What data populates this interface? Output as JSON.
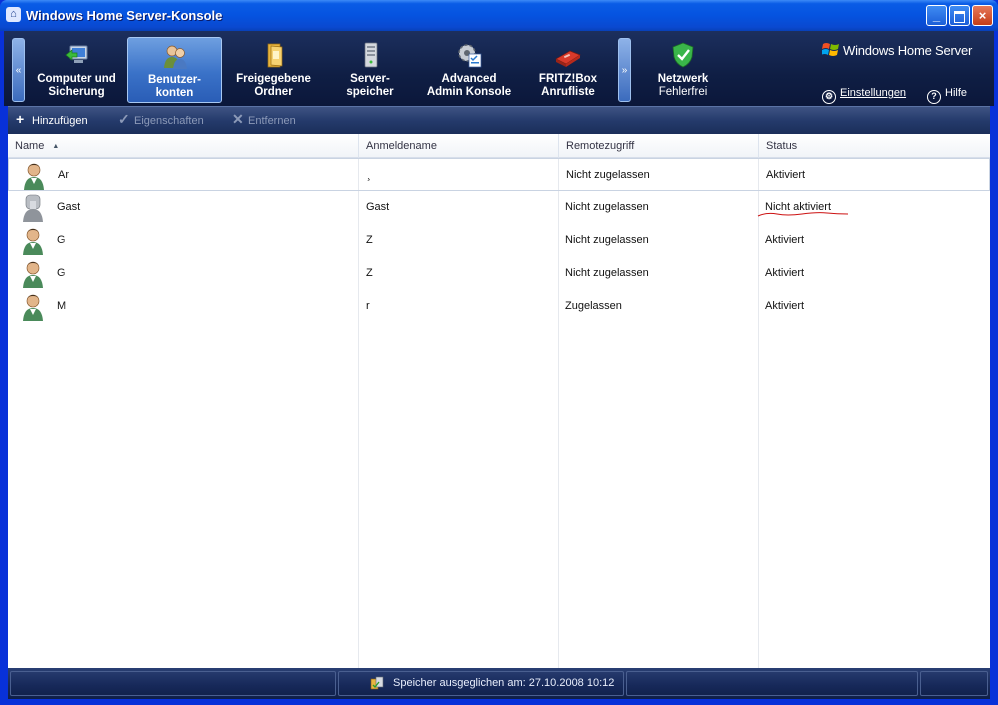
{
  "window": {
    "title": "Windows Home Server-Konsole",
    "minimize": "_",
    "close": "×"
  },
  "nav": {
    "scroll_left": "«",
    "scroll_right": "»",
    "tabs": [
      {
        "label": "Computer und Sicherung",
        "icon": "computer-backup-icon"
      },
      {
        "label": "Benutzer-konten",
        "icon": "users-icon"
      },
      {
        "label": "Freigegebene Ordner",
        "icon": "shared-folder-icon"
      },
      {
        "label": "Server-speicher",
        "icon": "server-storage-icon"
      },
      {
        "label": "Advanced Admin Konsole",
        "icon": "admin-console-icon"
      },
      {
        "label": "FRITZ!Box Anrufliste",
        "icon": "fritzbox-icon"
      }
    ],
    "network": {
      "title": "Netzwerk",
      "status": "Fehlerfrei",
      "icon": "shield-check-icon"
    },
    "brand": "Windows Home Server",
    "settings": "Einstellungen",
    "help": "Hilfe"
  },
  "toolbar": {
    "add": "Hinzufügen",
    "properties": "Eigenschaften",
    "remove": "Entfernen"
  },
  "table": {
    "columns": [
      "Name",
      "Anmeldename",
      "Remotezugriff",
      "Status"
    ],
    "sort_indicator": "▲",
    "rows": [
      {
        "name": "Ar",
        "login": "¸",
        "remote": "Nicht zugelassen",
        "status": "Aktiviert"
      },
      {
        "name": "Gast",
        "login": "Gast",
        "remote": "Nicht zugelassen",
        "status": "Nicht aktiviert"
      },
      {
        "name": "G",
        "login": "Z",
        "remote": "Nicht zugelassen",
        "status": "Aktiviert"
      },
      {
        "name": "G",
        "login": "Z",
        "remote": "Nicht zugelassen",
        "status": "Aktiviert"
      },
      {
        "name": "M",
        "login": "r",
        "remote": "Zugelassen",
        "status": "Aktiviert"
      }
    ]
  },
  "statusbar": {
    "text": "Speicher ausgeglichen am: 27.10.2008 10:12"
  },
  "colors": {
    "xp_blue": "#0831d9",
    "header_dark": "#0f1e44",
    "active_tab": "#3a72c8",
    "red_mark": "#cc1111"
  }
}
